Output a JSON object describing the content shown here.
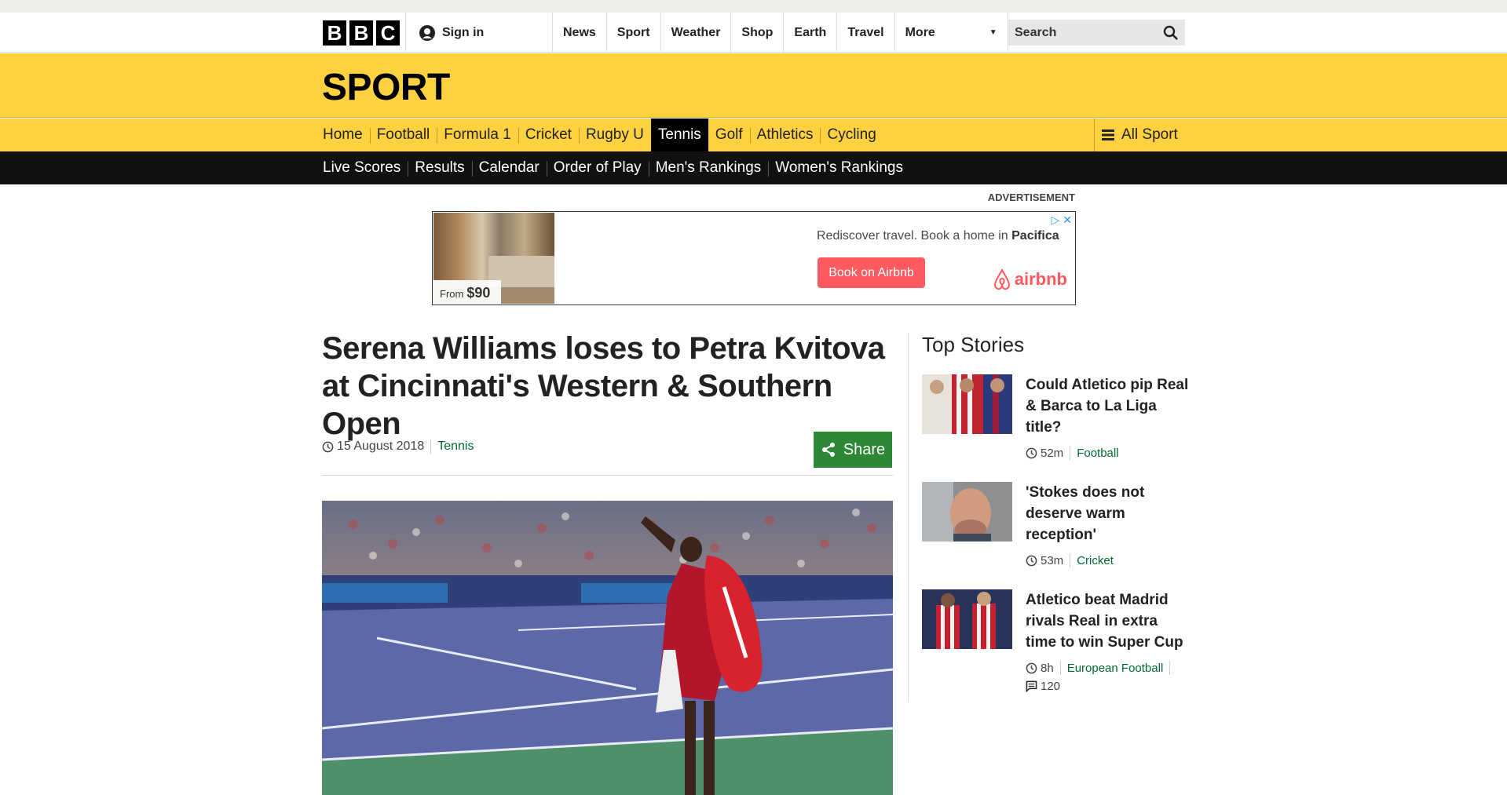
{
  "masthead": {
    "logo_letters": [
      "B",
      "B",
      "C"
    ],
    "signin_label": "Sign in",
    "nav": [
      "News",
      "Sport",
      "Weather",
      "Shop",
      "Earth",
      "Travel"
    ],
    "more_label": "More",
    "search_placeholder": "Search"
  },
  "sport": {
    "title": "SPORT",
    "nav": [
      {
        "label": "Home"
      },
      {
        "label": "Football"
      },
      {
        "label": "Formula 1"
      },
      {
        "label": "Cricket"
      },
      {
        "label": "Rugby U"
      },
      {
        "label": "Tennis",
        "active": true
      },
      {
        "label": "Golf"
      },
      {
        "label": "Athletics"
      },
      {
        "label": "Cycling"
      }
    ],
    "all_sport_label": "All Sport",
    "subnav": [
      "Live Scores",
      "Results",
      "Calendar",
      "Order of Play",
      "Men's Rankings",
      "Women's Rankings"
    ]
  },
  "ad": {
    "label": "ADVERTISEMENT",
    "price_from": "From",
    "price": "$90",
    "text": "Rediscover travel. Book a home in",
    "text_place": "Pacifica",
    "cta": "Book on Airbnb",
    "brand": "airbnb",
    "colors": {
      "brand": "#ff5a5f",
      "adchoices": "#2a9bd8"
    }
  },
  "article": {
    "headline": "Serena Williams loses to Petra Kvitova at Cincinnati's Western & Southern Open",
    "date": "15 August 2018",
    "tag": "Tennis",
    "share_label": "Share",
    "colors": {
      "share": "#2c8834",
      "tag": "#006a32"
    }
  },
  "sidebar": {
    "title": "Top Stories",
    "stories": [
      {
        "title": "Could Atletico pip Real & Barca to La Liga title?",
        "time": "52m",
        "tag": "Football"
      },
      {
        "title": "'Stokes does not deserve warm reception'",
        "time": "53m",
        "tag": "Cricket"
      },
      {
        "title": "Atletico beat Madrid rivals Real in extra time to win Super Cup",
        "time": "8h",
        "tag": "European Football",
        "comments": "120"
      }
    ]
  },
  "colors": {
    "sport_yellow": "#fed140",
    "subnav_black": "#111111"
  }
}
